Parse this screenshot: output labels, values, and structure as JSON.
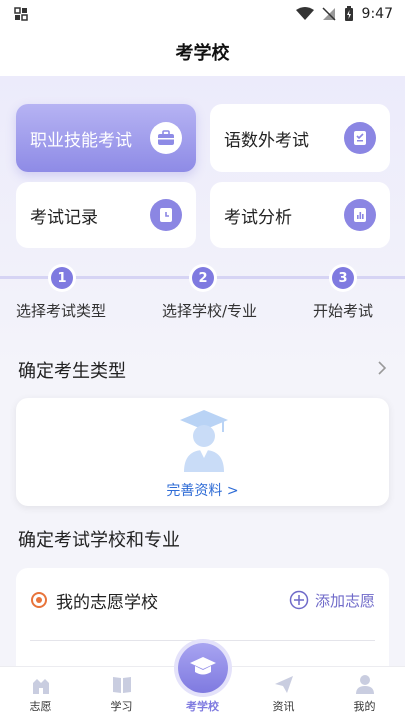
{
  "status_bar": {
    "time": "9:47"
  },
  "header": {
    "title": "考学校"
  },
  "cards": [
    {
      "label": "职业技能考试",
      "icon": "briefcase-icon"
    },
    {
      "label": "语数外考试",
      "icon": "checklist-icon"
    },
    {
      "label": "考试记录",
      "icon": "clock-icon"
    },
    {
      "label": "考试分析",
      "icon": "chart-icon"
    }
  ],
  "steps": [
    {
      "num": "1",
      "label": "选择考试类型"
    },
    {
      "num": "2",
      "label": "选择学校/专业"
    },
    {
      "num": "3",
      "label": "开始考试"
    }
  ],
  "profile": {
    "title": "确定考生类型",
    "link": "完善资料 >"
  },
  "school": {
    "title": "确定考试学校和专业",
    "my_school": "我的志愿学校",
    "add": "添加志愿"
  },
  "tabs": [
    {
      "label": "志愿",
      "icon": "castle-icon"
    },
    {
      "label": "学习",
      "icon": "book-icon"
    },
    {
      "label": "考学校",
      "icon": "graduation-cap-icon"
    },
    {
      "label": "资讯",
      "icon": "paper-plane-icon"
    },
    {
      "label": "我的",
      "icon": "person-icon"
    }
  ],
  "colors": {
    "accent": "#7f7ae0",
    "link": "#2f6cd6"
  }
}
